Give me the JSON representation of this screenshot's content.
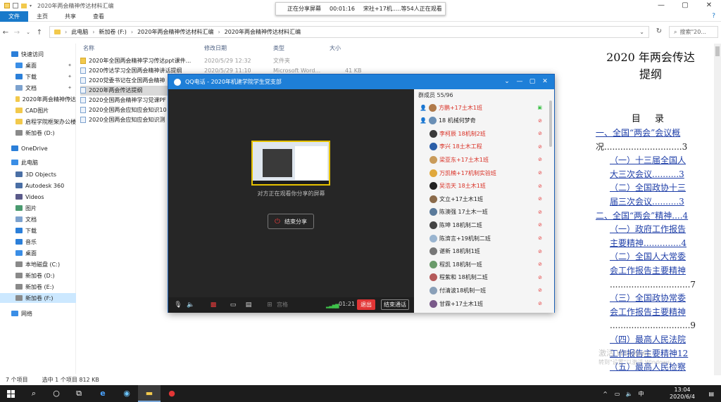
{
  "window": {
    "title": "2020年两会精神传达材料汇编",
    "controls": [
      "—",
      "▢",
      "✕"
    ]
  },
  "share_banner": {
    "label": "正在分享屏幕",
    "time": "00:01:16",
    "viewers": "宋社+17机.....等54人正在观看"
  },
  "ribbon": {
    "tabs": [
      "文件",
      "主页",
      "共享",
      "查看"
    ],
    "help": "?"
  },
  "address": {
    "segments": [
      "此电脑",
      "新加卷 (F:)",
      "2020年两会精神传达材料汇编",
      "2020年两会精神传达材料汇编"
    ],
    "search_placeholder": "搜索\"20..."
  },
  "nav": {
    "items": [
      {
        "label": "快速访问",
        "kind": "star"
      },
      {
        "label": "桌面",
        "kind": "desk",
        "pin": true
      },
      {
        "label": "下载",
        "kind": "down",
        "pin": true
      },
      {
        "label": "文档",
        "kind": "doc",
        "pin": true
      },
      {
        "label": "2020年两会精神传达",
        "kind": "folder",
        "pin": true
      },
      {
        "label": "CAD图片",
        "kind": "folder"
      },
      {
        "label": "启程学院框架办公楼",
        "kind": "folder"
      },
      {
        "label": "新加卷 (D:)",
        "kind": "drive"
      },
      {
        "label": "OneDrive",
        "kind": "cloud"
      },
      {
        "label": "此电脑",
        "kind": "pc"
      },
      {
        "label": "3D Objects",
        "kind": "obj"
      },
      {
        "label": "Autodesk 360",
        "kind": "obj"
      },
      {
        "label": "Videos",
        "kind": "video"
      },
      {
        "label": "图片",
        "kind": "pic"
      },
      {
        "label": "文档",
        "kind": "doc"
      },
      {
        "label": "下载",
        "kind": "down"
      },
      {
        "label": "音乐",
        "kind": "music"
      },
      {
        "label": "桌面",
        "kind": "desk"
      },
      {
        "label": "本地磁盘 (C:)",
        "kind": "drive"
      },
      {
        "label": "新加卷 (D:)",
        "kind": "drive"
      },
      {
        "label": "新加卷 (E:)",
        "kind": "drive"
      },
      {
        "label": "新加卷 (F:)",
        "kind": "drive",
        "selected": true
      },
      {
        "label": "网络",
        "kind": "net"
      }
    ]
  },
  "files": {
    "headers": {
      "name": "名称",
      "date": "修改日期",
      "type": "类型",
      "size": "大小"
    },
    "rows": [
      {
        "name": "2020年全国两会精神学习传达ppt课件...",
        "date": "2020/5/29 12:32",
        "type": "文件夹",
        "size": "",
        "folder": true
      },
      {
        "name": "2020传达学习全国两会精神讲话提纲",
        "date": "2020/5/29 11:10",
        "type": "Microsoft Word...",
        "size": "41 KB"
      },
      {
        "name": "2020党委书记在全国两会精神",
        "date": "",
        "type": "",
        "size": ""
      },
      {
        "name": "2020年两会传达提纲",
        "date": "",
        "type": "",
        "size": "",
        "selected": true
      },
      {
        "name": "2020全国两会精神学习党课PF",
        "date": "",
        "type": "",
        "size": ""
      },
      {
        "name": "2020全国两会应知应会知识10",
        "date": "",
        "type": "",
        "size": ""
      },
      {
        "name": "2020全国两会应知应会知识测",
        "date": "",
        "type": "",
        "size": ""
      }
    ]
  },
  "status": {
    "count": "7 个项目",
    "selection": "选中 1 个项目  812 KB"
  },
  "preview": {
    "title_line1": "2020 年两会传达",
    "title_line2": "提纲",
    "toc_head": "目 录",
    "toc_lines": [
      {
        "text": "一、全国“两会”会议概",
        "indent": 0,
        "link": true
      },
      {
        "text": "况.............................3",
        "indent": 0,
        "link": false
      },
      {
        "text": "（一）十三届全国人",
        "indent": 1,
        "link": true
      },
      {
        "text": "大三次会议..........3",
        "indent": 1,
        "link": true
      },
      {
        "text": "（二）全国政协十三",
        "indent": 1,
        "link": true
      },
      {
        "text": "届三次会议..........3",
        "indent": 1,
        "link": true
      },
      {
        "text": "二、全国“两会”精神....4",
        "indent": 0,
        "link": true
      },
      {
        "text": "（一）政府工作报告",
        "indent": 1,
        "link": true
      },
      {
        "text": "主要精神..............4",
        "indent": 1,
        "link": true
      },
      {
        "text": "（二）全国人大常委",
        "indent": 1,
        "link": true
      },
      {
        "text": "会工作报告主要精神",
        "indent": 1,
        "link": true
      },
      {
        "text": "..............................7",
        "indent": 1,
        "link": false
      },
      {
        "text": "（三）全国政协常委",
        "indent": 1,
        "link": true
      },
      {
        "text": "会工作报告主要精神",
        "indent": 1,
        "link": true
      },
      {
        "text": "..............................9",
        "indent": 1,
        "link": false
      },
      {
        "text": "（四）最高人民法院",
        "indent": 1,
        "link": true
      },
      {
        "text": "工作报告主要精神12",
        "indent": 1,
        "link": true
      },
      {
        "text": "（五）最高人民检察",
        "indent": 1,
        "link": true
      }
    ],
    "watermark": "激活 Windows",
    "watermark_sub": "转到\"设置\"以激活 Windows。"
  },
  "qq": {
    "title": "QQ电话 - 2020年机建学院学生党支部",
    "stage_msg": "对方正在观看你分享的屏幕",
    "end_share": "结束分享",
    "toolbar_text": "宫格",
    "timer": "01:21",
    "exit": "退出",
    "end_call": "结束通话",
    "member_count": "群成员 55/96",
    "members": [
      {
        "name": "方鹏+17土木1班",
        "red": true,
        "mic": "on",
        "person": true
      },
      {
        "name": "18 机械何梦奇",
        "red": false,
        "mic": "off",
        "person": true
      },
      {
        "name": "李柯辰 18机制2班",
        "red": true,
        "mic": "off"
      },
      {
        "name": "李兴 18土木工程",
        "red": true,
        "mic": "off"
      },
      {
        "name": "梁亚东+17土木1班",
        "red": true,
        "mic": "off"
      },
      {
        "name": "万凯楠+17机制实验班",
        "red": true,
        "mic": "off"
      },
      {
        "name": "吴浩天 18土木1班",
        "red": true,
        "mic": "off"
      },
      {
        "name": "文立+17土木1班",
        "red": false,
        "mic": "off"
      },
      {
        "name": "陈澳强 17土木一班",
        "red": false,
        "mic": "off"
      },
      {
        "name": "陈坤 18机制二班",
        "red": false,
        "mic": "off"
      },
      {
        "name": "陈濟言+19机制二班",
        "red": false,
        "mic": "off"
      },
      {
        "name": "谌新 18机制1班",
        "red": false,
        "mic": "off"
      },
      {
        "name": "程凯 18机制一班",
        "red": false,
        "mic": "off"
      },
      {
        "name": "程紫和 18机制二班",
        "red": false,
        "mic": "off"
      },
      {
        "name": "付清波18机制一班",
        "red": false,
        "mic": "off"
      },
      {
        "name": "甘霖+17土木1班",
        "red": false,
        "mic": "off"
      }
    ]
  },
  "taskbar": {
    "time": "13:04",
    "date": "2020/6/4",
    "ime": "中",
    "tray_arrow": "^"
  },
  "colors": {
    "accent": "#1979ca",
    "qq_header": "#1e7fd8",
    "exit_red": "#e23636",
    "link_blue": "#1f3fa8"
  }
}
